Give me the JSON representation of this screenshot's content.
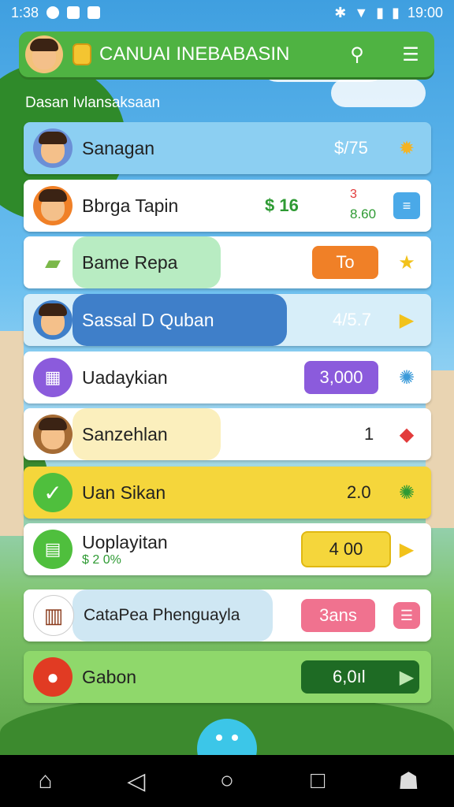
{
  "status": {
    "time_left": "1:38",
    "time_right": "19:00"
  },
  "header": {
    "title": "CANUAI INEBABASIN"
  },
  "subtitle": "Dasan Ivlansaksaan",
  "rows": [
    {
      "label": "Sanagan",
      "value": "$/75",
      "action_icon": "sun-gear"
    },
    {
      "label": "Bbrga Tapin",
      "value": "$ 16",
      "extra": "8.60",
      "extra_top": "3",
      "action_icon": "list"
    },
    {
      "label": "Bame Repa",
      "pill": "To",
      "action_icon": "star"
    },
    {
      "label": "Sassal D Quban",
      "value": "4/5.7",
      "action_icon": "play"
    },
    {
      "label": "Uadaykian",
      "pill": "3,000",
      "action_icon": "gear"
    },
    {
      "label": "Sanzehlan",
      "value": "1",
      "action_icon": "gem"
    },
    {
      "label": "Uan Sikan",
      "value": "2.0",
      "action_icon": "gear"
    },
    {
      "label": "Uoplayitan",
      "sub": "$ 2 0%",
      "pill": "4 00",
      "action_icon": "play"
    },
    {
      "label": "CataPea Phenguayla",
      "pill": "3ans",
      "action_icon": "menu"
    },
    {
      "label": "Gabon",
      "pill": "6,0ıl",
      "action_icon": "play"
    }
  ],
  "colors": {
    "header": "#4fb342",
    "orange": "#f08027",
    "purple": "#8b5bdc",
    "yellow": "#f5d63b",
    "pink": "#f0728f",
    "darkgreen": "#1e6b24"
  }
}
